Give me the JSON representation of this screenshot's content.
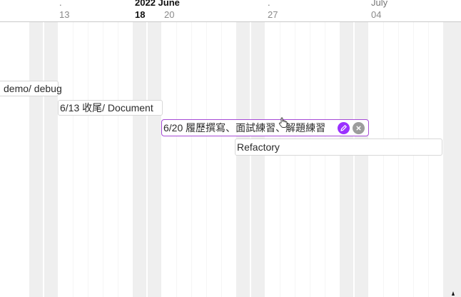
{
  "header": {
    "month_markers": [
      {
        "name": "june",
        "text": ".",
        "bold": false
      },
      {
        "name": "year-june",
        "text": "2022 June",
        "bold": true
      },
      {
        "name": "dot-27",
        "text": ".",
        "bold": false
      },
      {
        "name": "july",
        "text": "July",
        "bold": false
      }
    ],
    "day_labels": [
      {
        "name": "13",
        "text": "13",
        "bold": false
      },
      {
        "name": "18",
        "text": "18",
        "bold": true
      },
      {
        "name": "20",
        "text": "20",
        "bold": false
      },
      {
        "name": "27",
        "text": "27",
        "bold": false
      },
      {
        "name": "04",
        "text": "04",
        "bold": false
      }
    ]
  },
  "tasks": [
    {
      "name": "demo-debug",
      "label": "demo/ debug",
      "selected": false
    },
    {
      "name": "document",
      "label": "6/13 收尾/ Document",
      "selected": false
    },
    {
      "name": "resume",
      "label": "6/20 履歷撰寫、面試練習、解題練習",
      "selected": true
    },
    {
      "name": "refactory",
      "label": "Refactory",
      "selected": false
    }
  ],
  "colors": {
    "accent": "#9b30ff",
    "selected_border": "#a64bd6",
    "weekend": "#efefef",
    "remove_button": "#9c9c9c"
  },
  "icons": {
    "edit": "pencil-icon",
    "remove": "close-icon",
    "cursor": "hand-pointer-icon"
  }
}
